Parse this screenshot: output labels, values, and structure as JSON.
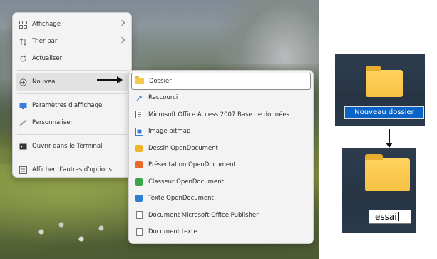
{
  "context_menu": {
    "items": [
      {
        "label": "Affichage",
        "icon": "grid-icon",
        "has_submenu": true
      },
      {
        "label": "Trier par",
        "icon": "sort-icon",
        "has_submenu": true
      },
      {
        "label": "Actualiser",
        "icon": "refresh-icon",
        "has_submenu": false
      },
      {
        "label": "Nouveau",
        "icon": "new-plus-icon",
        "has_submenu": true
      },
      {
        "label": "Paramètres d'affichage",
        "icon": "display-icon",
        "has_submenu": false
      },
      {
        "label": "Personnaliser",
        "icon": "brush-icon",
        "has_submenu": false
      },
      {
        "label": "Ouvrir dans le Terminal",
        "icon": "terminal-icon",
        "has_submenu": false
      },
      {
        "label": "Afficher d'autres d'options",
        "icon": "more-options-icon",
        "has_submenu": false
      }
    ]
  },
  "submenu_new": {
    "items": [
      {
        "label": "Dossier",
        "icon": "folder-icon"
      },
      {
        "label": "Raccourci",
        "icon": "shortcut-icon"
      },
      {
        "label": "Microsoft Office Access 2007 Base de données",
        "icon": "access-db-icon"
      },
      {
        "label": "Image bitmap",
        "icon": "bitmap-icon"
      },
      {
        "label": "Dessin OpenDocument",
        "icon": "draw-icon"
      },
      {
        "label": "Présentation OpenDocument",
        "icon": "impress-icon"
      },
      {
        "label": "Classeur OpenDocument",
        "icon": "calc-icon"
      },
      {
        "label": "Texte OpenDocument",
        "icon": "writer-icon"
      },
      {
        "label": "Document Microsoft Office Publisher",
        "icon": "publisher-icon"
      },
      {
        "label": "Document texte",
        "icon": "text-doc-icon"
      }
    ]
  },
  "new_folder": {
    "default_name": "Nouveau dossier",
    "renamed_value": "essai"
  },
  "colors": {
    "selection_blue": "#0a64c8",
    "folder_yellow": "#f6c142",
    "menu_bg": "#f3f3f3"
  }
}
